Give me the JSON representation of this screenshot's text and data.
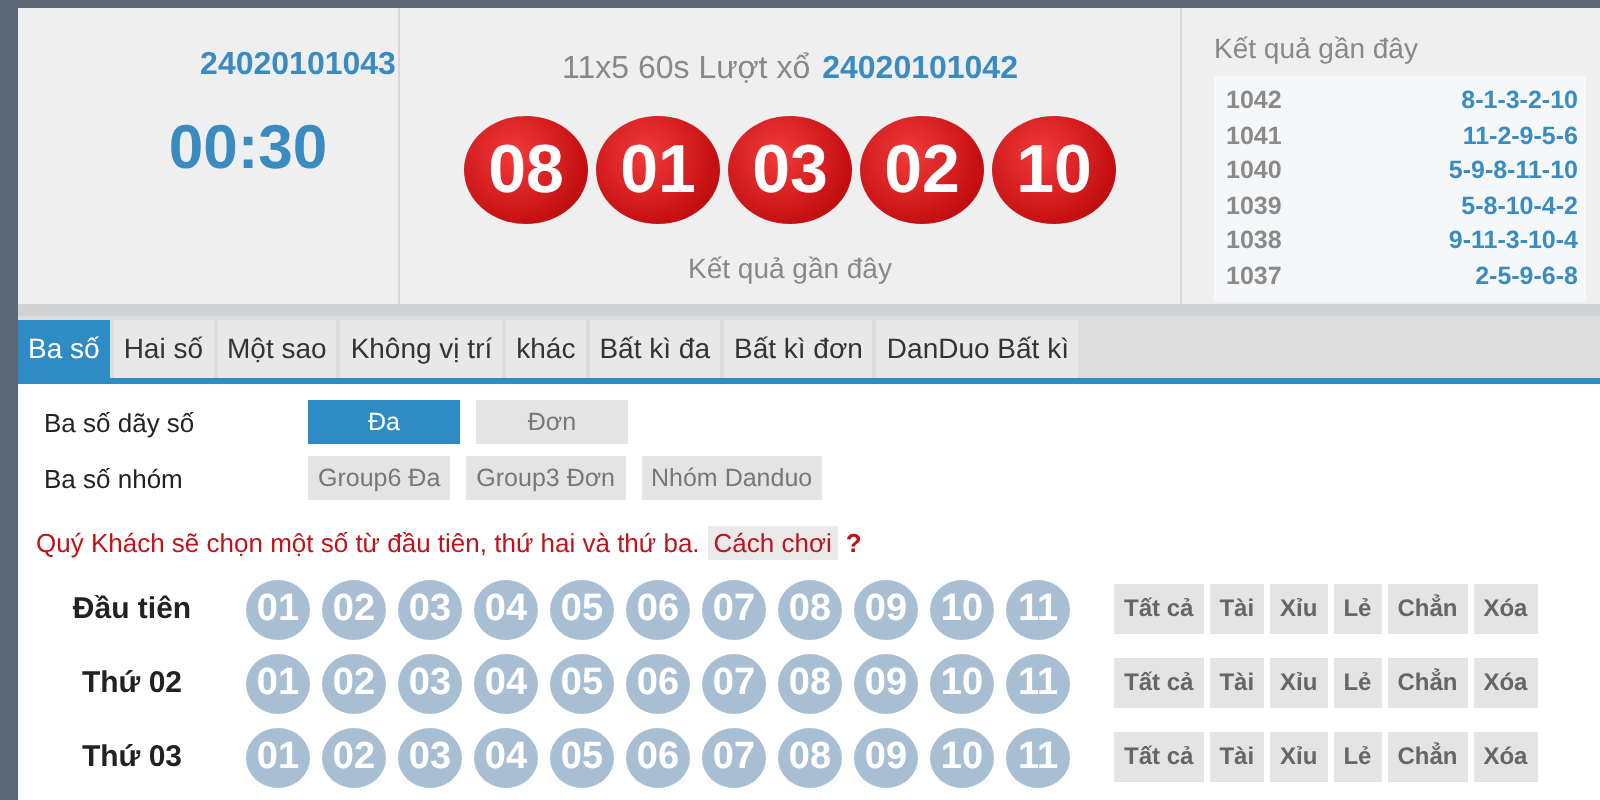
{
  "header": {
    "next_draw": {
      "number": "24020101043",
      "timer": "00:30"
    },
    "current": {
      "title": "11x5 60s Lượt xổ",
      "number": "24020101042",
      "balls": [
        "08",
        "01",
        "03",
        "02",
        "10"
      ],
      "caption": "Kết quả gần đây"
    },
    "recent": {
      "title": "Kết quả gần đây",
      "rows": [
        {
          "draw": "1042",
          "result": "8-1-3-2-10"
        },
        {
          "draw": "1041",
          "result": "11-2-9-5-6"
        },
        {
          "draw": "1040",
          "result": "5-9-8-11-10"
        },
        {
          "draw": "1039",
          "result": "5-8-10-4-2"
        },
        {
          "draw": "1038",
          "result": "9-11-3-10-4"
        },
        {
          "draw": "1037",
          "result": "2-5-9-6-8"
        }
      ]
    }
  },
  "tabs": [
    {
      "label": "Ba số",
      "selected": true
    },
    {
      "label": "Hai số",
      "selected": false
    },
    {
      "label": "Một sao",
      "selected": false
    },
    {
      "label": "Không vị trí",
      "selected": false
    },
    {
      "label": "khác",
      "selected": false
    },
    {
      "label": "Bất kì đa",
      "selected": false
    },
    {
      "label": "Bất kì đơn",
      "selected": false
    },
    {
      "label": "DanDuo Bất kì",
      "selected": false
    }
  ],
  "options": [
    {
      "label": "Ba số dãy số",
      "choices": [
        {
          "label": "Đa",
          "selected": true
        },
        {
          "label": "Đơn",
          "selected": false
        }
      ]
    },
    {
      "label": "Ba số nhóm",
      "choices": [
        {
          "label": "Group6 Đa",
          "selected": false
        },
        {
          "label": "Group3 Đơn",
          "selected": false
        },
        {
          "label": "Nhóm Danduo",
          "selected": false
        }
      ]
    }
  ],
  "hint": {
    "text": "Quý Khách sẽ chọn một số từ đầu tiên, thứ hai và thứ ba.",
    "link": "Cách chơi",
    "mark": "?"
  },
  "positions": [
    {
      "label": "Đầu tiên",
      "numbers": [
        {
          "label": "01",
          "selected": false
        },
        {
          "label": "02",
          "selected": false
        },
        {
          "label": "03",
          "selected": false
        },
        {
          "label": "04",
          "selected": false
        },
        {
          "label": "05",
          "selected": false
        },
        {
          "label": "06",
          "selected": false
        },
        {
          "label": "07",
          "selected": false
        },
        {
          "label": "08",
          "selected": false
        },
        {
          "label": "09",
          "selected": false
        },
        {
          "label": "10",
          "selected": false
        },
        {
          "label": "11",
          "selected": false
        }
      ],
      "actions": [
        "Tất cả",
        "Tài",
        "Xỉu",
        "Lẻ",
        "Chẳn",
        "Xóa"
      ]
    },
    {
      "label": "Thứ 02",
      "numbers": [
        {
          "label": "01",
          "selected": false
        },
        {
          "label": "02",
          "selected": false
        },
        {
          "label": "03",
          "selected": false
        },
        {
          "label": "04",
          "selected": false
        },
        {
          "label": "05",
          "selected": false
        },
        {
          "label": "06",
          "selected": false
        },
        {
          "label": "07",
          "selected": false
        },
        {
          "label": "08",
          "selected": false
        },
        {
          "label": "09",
          "selected": false
        },
        {
          "label": "10",
          "selected": false
        },
        {
          "label": "11",
          "selected": false
        }
      ],
      "actions": [
        "Tất cả",
        "Tài",
        "Xỉu",
        "Lẻ",
        "Chẳn",
        "Xóa"
      ]
    },
    {
      "label": "Thứ 03",
      "numbers": [
        {
          "label": "01",
          "selected": false
        },
        {
          "label": "02",
          "selected": false
        },
        {
          "label": "03",
          "selected": false
        },
        {
          "label": "04",
          "selected": false
        },
        {
          "label": "05",
          "selected": false
        },
        {
          "label": "06",
          "selected": false
        },
        {
          "label": "07",
          "selected": false
        },
        {
          "label": "08",
          "selected": false
        },
        {
          "label": "09",
          "selected": false
        },
        {
          "label": "10",
          "selected": false
        },
        {
          "label": "11",
          "selected": false
        }
      ],
      "actions": [
        "Tất cả",
        "Tài",
        "Xỉu",
        "Lẻ",
        "Chẳn",
        "Xóa"
      ]
    }
  ]
}
